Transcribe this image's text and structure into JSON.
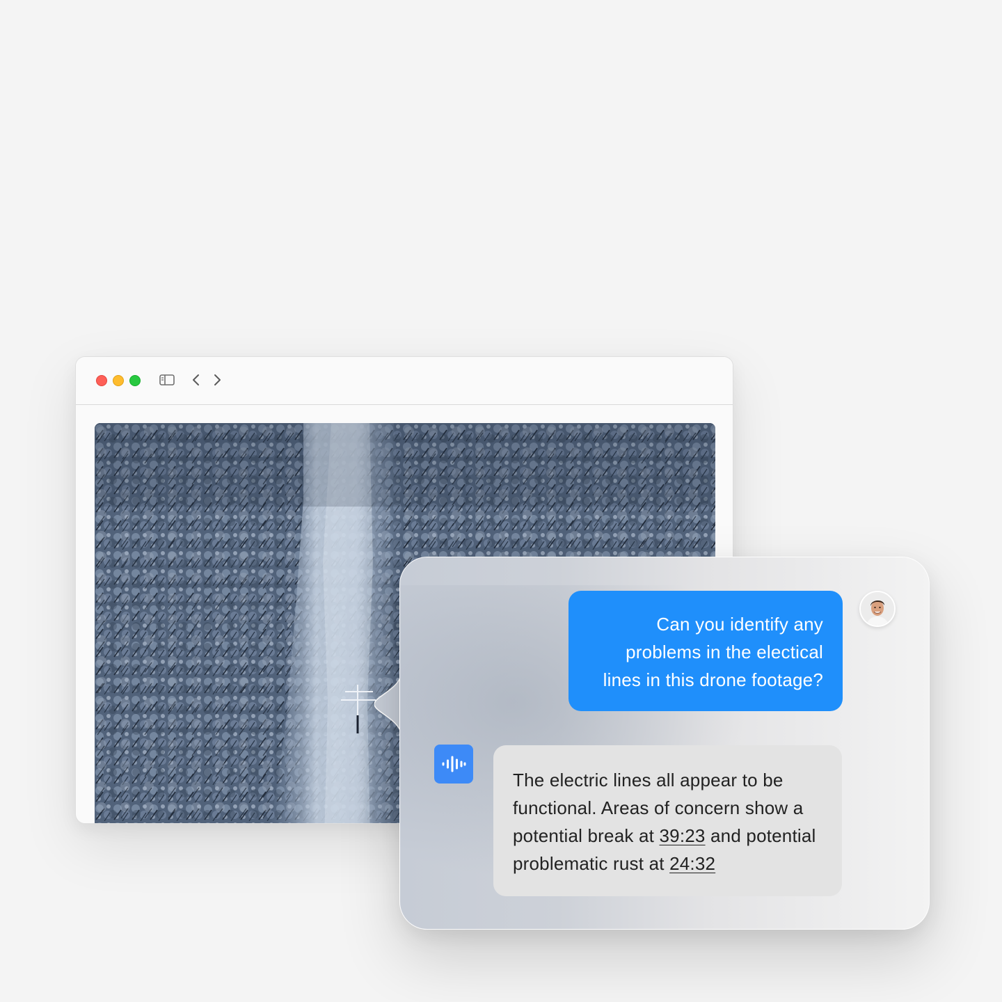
{
  "window": {
    "traffic_lights": [
      "close",
      "minimize",
      "zoom"
    ],
    "toolbar_icons": [
      "sidebar-toggle-icon",
      "back-chevron-icon",
      "forward-chevron-icon"
    ]
  },
  "media": {
    "icon": "drone-footage-aerial-forest"
  },
  "chat": {
    "user_message": "Can you identify any problems in the electical lines in this drone footage?",
    "assistant_message": {
      "part1": "The electric lines all appear to be functional. Areas of concern show a potential break at ",
      "timestamp1": "39:23",
      "part2": " and potential problematic rust at ",
      "timestamp2": "24:32"
    }
  },
  "colors": {
    "user_bubble": "#1f8ffb",
    "assistant_bubble": "#e3e3e3",
    "assistant_icon": "#3d8af7",
    "close": "#fe5f57",
    "minimize": "#febc2e",
    "zoom": "#28c840"
  }
}
